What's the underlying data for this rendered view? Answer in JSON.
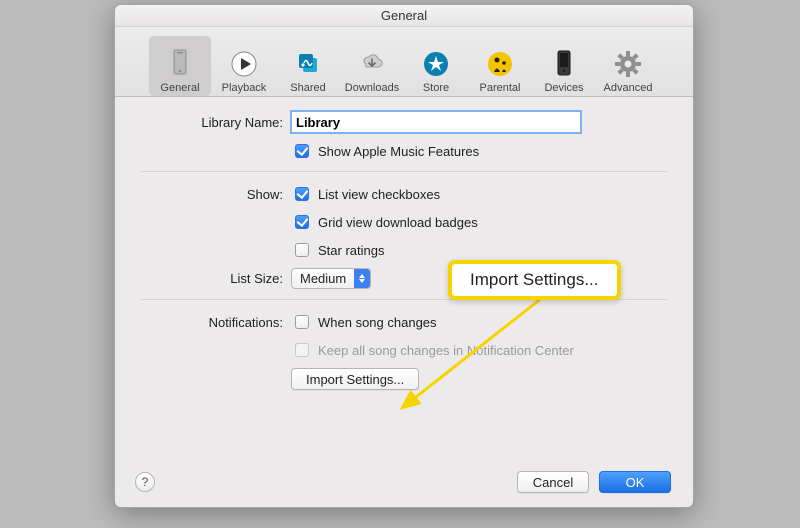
{
  "window": {
    "title": "General"
  },
  "toolbar": {
    "items": [
      {
        "id": "general",
        "label": "General",
        "selected": true
      },
      {
        "id": "playback",
        "label": "Playback",
        "selected": false
      },
      {
        "id": "shared",
        "label": "Shared",
        "selected": false
      },
      {
        "id": "downloads",
        "label": "Downloads",
        "selected": false
      },
      {
        "id": "store",
        "label": "Store",
        "selected": false
      },
      {
        "id": "parental",
        "label": "Parental",
        "selected": false
      },
      {
        "id": "devices",
        "label": "Devices",
        "selected": false
      },
      {
        "id": "advanced",
        "label": "Advanced",
        "selected": false
      }
    ]
  },
  "form": {
    "library_name_label": "Library Name:",
    "library_name_value": "Library",
    "show_apple_music_label": "Show Apple Music Features",
    "show_apple_music_checked": true,
    "show_label": "Show:",
    "list_view_checkboxes_label": "List view checkboxes",
    "list_view_checkboxes_checked": true,
    "grid_view_badges_label": "Grid view download badges",
    "grid_view_badges_checked": true,
    "star_ratings_label": "Star ratings",
    "star_ratings_checked": false,
    "list_size_label": "List Size:",
    "list_size_value": "Medium",
    "notifications_label": "Notifications:",
    "when_song_changes_label": "When song changes",
    "when_song_changes_checked": false,
    "keep_changes_label": "Keep all song changes in Notification Center",
    "keep_changes_checked": false,
    "import_settings_label": "Import Settings..."
  },
  "footer": {
    "help_glyph": "?",
    "cancel_label": "Cancel",
    "ok_label": "OK"
  },
  "callout": {
    "text": "Import Settings..."
  }
}
